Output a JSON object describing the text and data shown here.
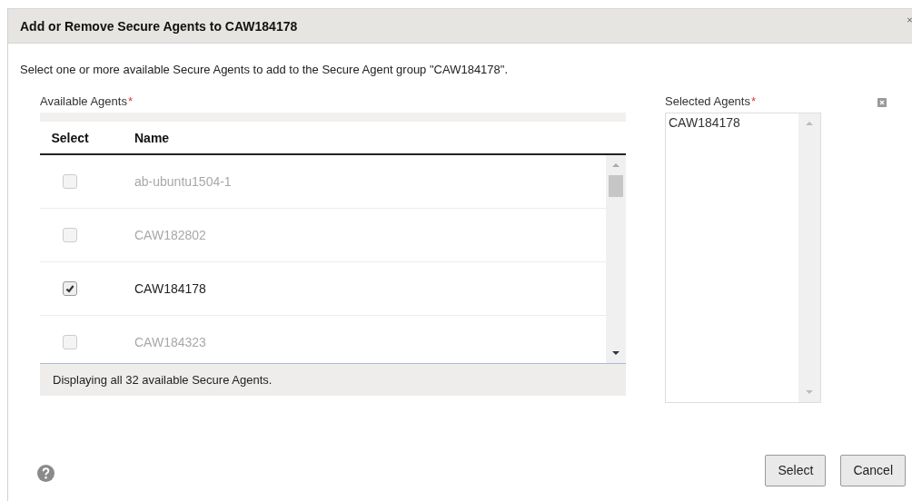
{
  "dialog": {
    "title": "Add or Remove Secure Agents to CAW184178",
    "instruction": "Select one or more available Secure Agents to add to the Secure Agent group \"CAW184178\"."
  },
  "available": {
    "label": "Available Agents",
    "required_mark": "*",
    "columns": [
      "Select",
      "Name"
    ],
    "rows": [
      {
        "name": "ab-ubuntu1504-1",
        "checked": false
      },
      {
        "name": "CAW182802",
        "checked": false
      },
      {
        "name": "CAW184178",
        "checked": true
      },
      {
        "name": "CAW184323",
        "checked": false
      }
    ],
    "footer": "Displaying all 32 available Secure Agents."
  },
  "selected": {
    "label": "Selected Agents",
    "required_mark": "*",
    "items": [
      "CAW184178"
    ]
  },
  "buttons": [
    "Select",
    "Cancel"
  ]
}
